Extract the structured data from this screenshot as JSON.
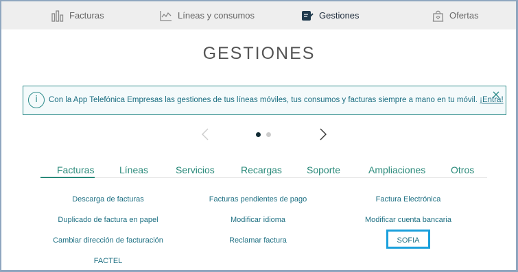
{
  "topnav": {
    "items": [
      {
        "label": "Facturas",
        "icon": "bar-chart-icon"
      },
      {
        "label": "Líneas y consumos",
        "icon": "line-chart-icon"
      },
      {
        "label": "Gestiones",
        "icon": "edit-document-icon",
        "active": true
      },
      {
        "label": "Ofertas",
        "icon": "shopping-bag-icon"
      }
    ]
  },
  "page": {
    "title": "GESTIONES"
  },
  "banner": {
    "text": "Con la App Telefónica Empresas las gestiones de tus líneas móviles, tus consumos y facturas siempre a mano en tu móvil. ",
    "link": "¡Entra!",
    "info_icon": "i"
  },
  "carousel": {
    "slides": 2,
    "active": 1
  },
  "tabs": {
    "items": [
      "Facturas",
      "Líneas",
      "Servicios",
      "Recargas",
      "Soporte",
      "Ampliaciones",
      "Otros"
    ],
    "active": 0
  },
  "options": {
    "col1": [
      "Descarga de facturas",
      "Duplicado de factura en papel",
      "Cambiar dirección de facturación",
      "FACTEL"
    ],
    "col2": [
      "Facturas pendientes de pago",
      "Modificar idioma",
      "Reclamar factura"
    ],
    "col3": [
      "Factura Electrónica",
      "Modificar cuenta bancaria",
      "SOFIA"
    ],
    "highlighted": "SOFIA"
  },
  "colors": {
    "accent": "#2a8a7a",
    "link": "#1d6f82",
    "highlight": "#1aa0dc",
    "nav_bg": "#eeeeee"
  }
}
